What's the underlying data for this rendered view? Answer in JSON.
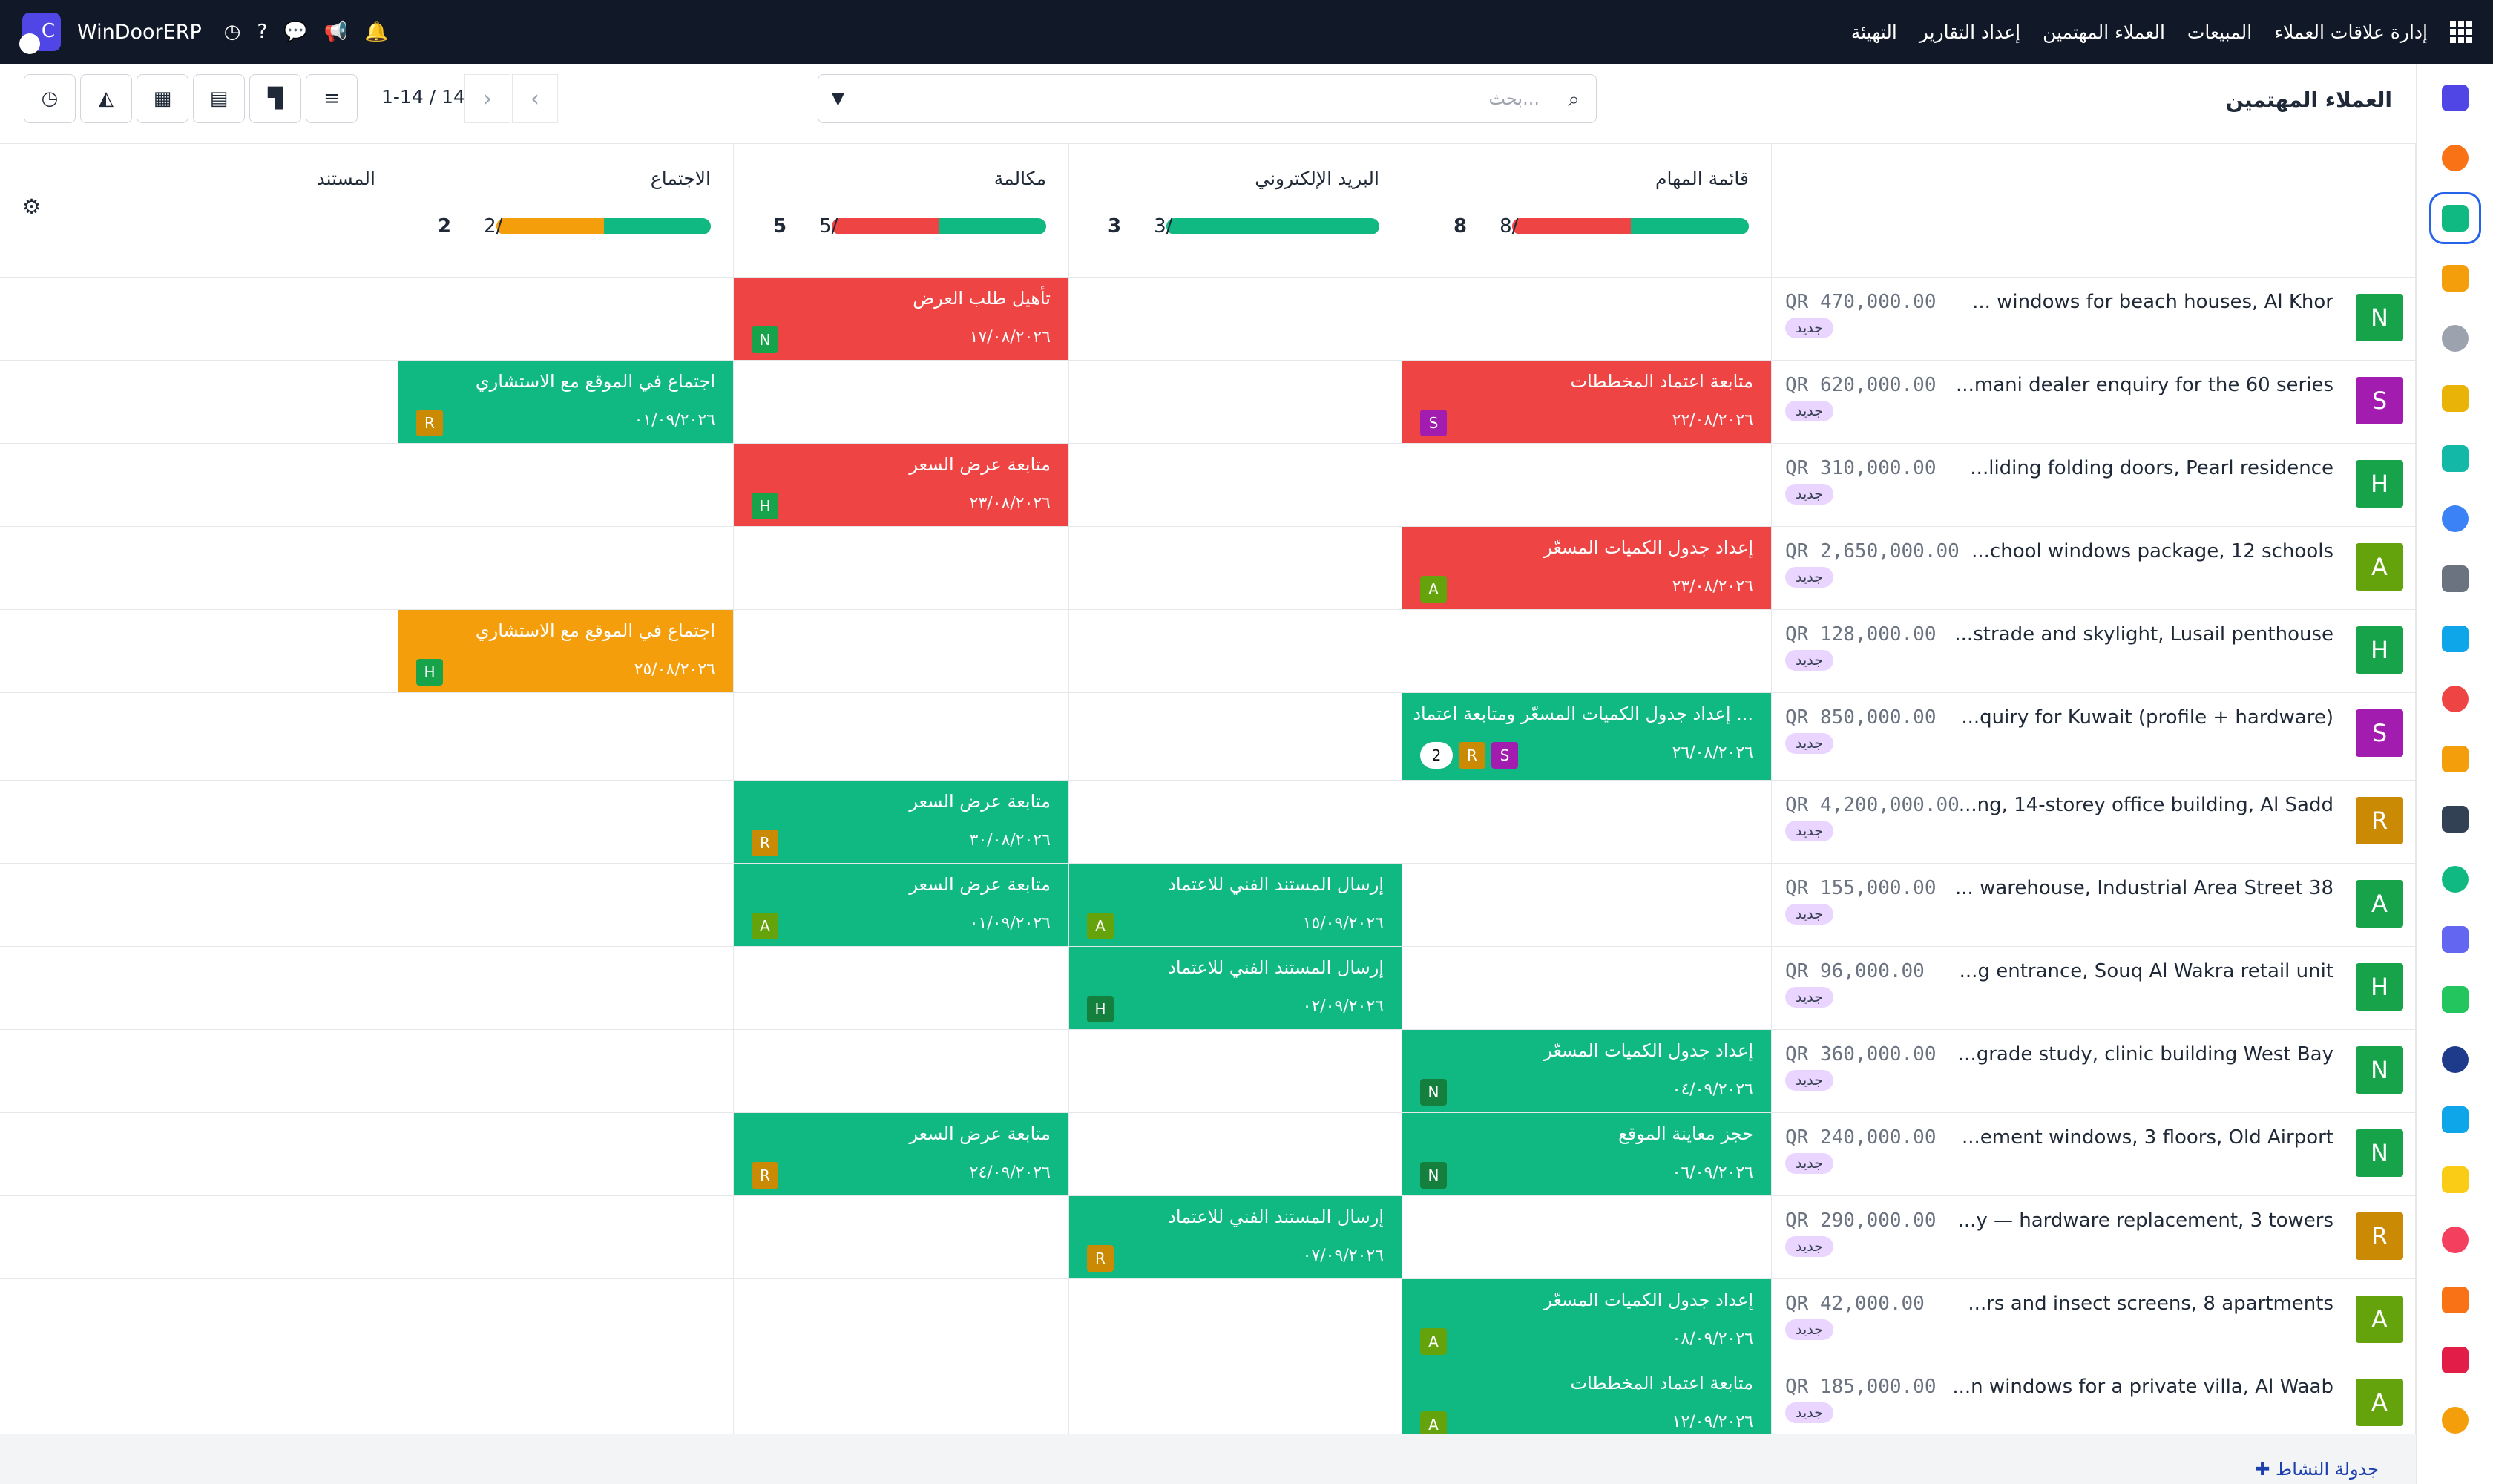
{
  "topbar": {
    "brand": "WinDoorERP",
    "menu": [
      "إدارة علاقات العملاء",
      "المبيعات",
      "العملاء المهتمين",
      "إعداد التقارير",
      "التهيئة"
    ]
  },
  "page": {
    "title": "العملاء المهتمين",
    "search_placeholder": "بحث...",
    "pager": "1-14 / 14"
  },
  "columns": [
    {
      "name": "قائمة المهام",
      "count": "8",
      "total": "8/",
      "segments": [
        {
          "c": "#ef4444",
          "p": 50
        },
        {
          "c": "#10b981",
          "p": 50
        }
      ]
    },
    {
      "name": "البريد الإلكتروني",
      "count": "3",
      "total": "3/",
      "segments": [
        {
          "c": "#10b981",
          "p": 100
        }
      ]
    },
    {
      "name": "مكالمة",
      "count": "5",
      "total": "5/",
      "segments": [
        {
          "c": "#ef4444",
          "p": 50
        },
        {
          "c": "#10b981",
          "p": 50
        }
      ]
    },
    {
      "name": "الاجتماع",
      "count": "2",
      "total": "2/",
      "segments": [
        {
          "c": "#f59e0b",
          "p": 50
        },
        {
          "c": "#10b981",
          "p": 50
        }
      ]
    },
    {
      "name": "المستند",
      "count": "",
      "total": "",
      "segments": []
    }
  ],
  "rows": [
    {
      "avatar": "N",
      "color": "#16a34a",
      "name": "... windows for beach houses, Al Khor",
      "amount": "QR 470,000.00",
      "badge": "جديد",
      "acts": [
        null,
        null,
        {
          "t": "تأهيل طلب العرض",
          "d": "١٧/٠٨/٢٠٢٦",
          "a": "N",
          "ac": "#16a34a",
          "s": "red"
        },
        null
      ]
    },
    {
      "avatar": "S",
      "color": "#a21caf",
      "name": "...mani dealer enquiry for the 60 series",
      "amount": "QR 620,000.00",
      "badge": "جديد",
      "acts": [
        {
          "t": "متابعة اعتماد المخططات",
          "d": "٢٢/٠٨/٢٠٢٦",
          "a": "S",
          "ac": "#a21caf",
          "s": "red"
        },
        null,
        null,
        {
          "t": "اجتماع في الموقع مع الاستشاري",
          "d": "٠١/٠٩/٢٠٢٦",
          "a": "R",
          "ac": "#ca8a04",
          "s": "green"
        }
      ]
    },
    {
      "avatar": "H",
      "color": "#16a34a",
      "name": "...liding folding doors, Pearl residence",
      "amount": "QR 310,000.00",
      "badge": "جديد",
      "acts": [
        null,
        null,
        {
          "t": "متابعة عرض السعر",
          "d": "٢٣/٠٨/٢٠٢٦",
          "a": "H",
          "ac": "#16a34a",
          "s": "red"
        },
        null
      ]
    },
    {
      "avatar": "A",
      "color": "#65a30d",
      "name": "...chool windows package, 12 schools",
      "amount": "QR 2,650,000.00",
      "badge": "جديد",
      "acts": [
        {
          "t": "إعداد جدول الكميات المسعّر",
          "d": "٢٣/٠٨/٢٠٢٦",
          "a": "A",
          "ac": "#65a30d",
          "s": "red"
        },
        null,
        null,
        null
      ]
    },
    {
      "avatar": "H",
      "color": "#16a34a",
      "name": "...strade and skylight, Lusail penthouse",
      "amount": "QR 128,000.00",
      "badge": "جديد",
      "acts": [
        null,
        null,
        null,
        {
          "t": "اجتماع في الموقع مع الاستشاري",
          "d": "٢٥/٠٨/٢٠٢٦",
          "a": "H",
          "ac": "#16a34a",
          "s": "orange"
        }
      ]
    },
    {
      "avatar": "S",
      "color": "#a21caf",
      "name": "...quiry for Kuwait (profile + hardware)",
      "amount": "QR 850,000.00",
      "badge": "جديد",
      "acts": [
        {
          "t": "إعداد جدول الكميات المسعّر ومتابعة اعتماد ...",
          "d": "٢٦/٠٨/٢٠٢٦",
          "a": "S",
          "ac": "#a21caf",
          "s": "green",
          "extra": "R",
          "extraColor": "#ca8a04",
          "num": "2"
        },
        null,
        null,
        null
      ]
    },
    {
      "avatar": "R",
      "color": "#ca8a04",
      "name": "...ng, 14-storey office building, Al Sadd",
      "amount": "QR 4,200,000.00",
      "badge": "جديد",
      "acts": [
        null,
        null,
        {
          "t": "متابعة عرض السعر",
          "d": "٣٠/٠٨/٢٠٢٦",
          "a": "R",
          "ac": "#ca8a04",
          "s": "green"
        },
        null
      ]
    },
    {
      "avatar": "A",
      "color": "#16a34a",
      "name": "... warehouse, Industrial Area Street 38",
      "amount": "QR 155,000.00",
      "badge": "جديد",
      "acts": [
        null,
        {
          "t": "إرسال المستند الفني للاعتماد",
          "d": "١٥/٠٩/٢٠٢٦",
          "a": "A",
          "ac": "#65a30d",
          "s": "green"
        },
        {
          "t": "متابعة عرض السعر",
          "d": "٠١/٠٩/٢٠٢٦",
          "a": "A",
          "ac": "#65a30d",
          "s": "green"
        },
        null
      ]
    },
    {
      "avatar": "H",
      "color": "#16a34a",
      "name": "...g entrance, Souq Al Wakra retail unit",
      "amount": "QR 96,000.00",
      "badge": "جديد",
      "acts": [
        null,
        {
          "t": "إرسال المستند الفني للاعتماد",
          "d": "٠٢/٠٩/٢٠٢٦",
          "a": "H",
          "ac": "#15803d",
          "s": "green"
        },
        null,
        null
      ]
    },
    {
      "avatar": "N",
      "color": "#16a34a",
      "name": "...grade study, clinic building West Bay",
      "amount": "QR 360,000.00",
      "badge": "جديد",
      "acts": [
        {
          "t": "إعداد جدول الكميات المسعّر",
          "d": "٠٤/٠٩/٢٠٢٦",
          "a": "N",
          "ac": "#15803d",
          "s": "green"
        },
        null,
        null,
        null
      ]
    },
    {
      "avatar": "N",
      "color": "#16a34a",
      "name": "...ement windows, 3 floors, Old Airport",
      "amount": "QR 240,000.00",
      "badge": "جديد",
      "acts": [
        {
          "t": "حجز معاينة الموقع",
          "d": "٠٦/٠٩/٢٠٢٦",
          "a": "N",
          "ac": "#15803d",
          "s": "green"
        },
        null,
        {
          "t": "متابعة عرض السعر",
          "d": "٢٤/٠٩/٢٠٢٦",
          "a": "R",
          "ac": "#ca8a04",
          "s": "green"
        },
        null
      ]
    },
    {
      "avatar": "R",
      "color": "#ca8a04",
      "name": "...y — hardware replacement, 3 towers",
      "amount": "QR 290,000.00",
      "badge": "جديد",
      "acts": [
        null,
        {
          "t": "إرسال المستند الفني للاعتماد",
          "d": "٠٧/٠٩/٢٠٢٦",
          "a": "R",
          "ac": "#ca8a04",
          "s": "green"
        },
        null,
        null
      ]
    },
    {
      "avatar": "A",
      "color": "#65a30d",
      "name": "...rs and insect screens, 8 apartments",
      "amount": "QR 42,000.00",
      "badge": "جديد",
      "acts": [
        {
          "t": "إعداد جدول الكميات المسعّر",
          "d": "٠٨/٠٩/٢٠٢٦",
          "a": "A",
          "ac": "#65a30d",
          "s": "green"
        },
        null,
        null,
        null
      ]
    },
    {
      "avatar": "A",
      "color": "#65a30d",
      "name": "...n windows for a private villa, Al Waab",
      "amount": "QR 185,000.00",
      "badge": "جديد",
      "acts": [
        {
          "t": "متابعة اعتماد المخططات",
          "d": "١٢/٠٩/٢٠٢٦",
          "a": "A",
          "ac": "#65a30d",
          "s": "green"
        },
        null,
        null,
        null
      ]
    }
  ],
  "footer": {
    "link": "جدولة النشاط"
  },
  "sidebar_colors": [
    "#4f46e5",
    "#f97316",
    "#10b981",
    "#f59e0b",
    "#9ca3af",
    "#eab308",
    "#14b8a6",
    "#3b82f6",
    "#6b7280",
    "#0ea5e9",
    "#ef4444",
    "#f59e0b",
    "#334155",
    "#10b981",
    "#6366f1",
    "#22c55e",
    "#1e3a8a",
    "#0ea5e9",
    "#facc15",
    "#f43f5e",
    "#f97316",
    "#e11d48",
    "#f59e0b"
  ]
}
